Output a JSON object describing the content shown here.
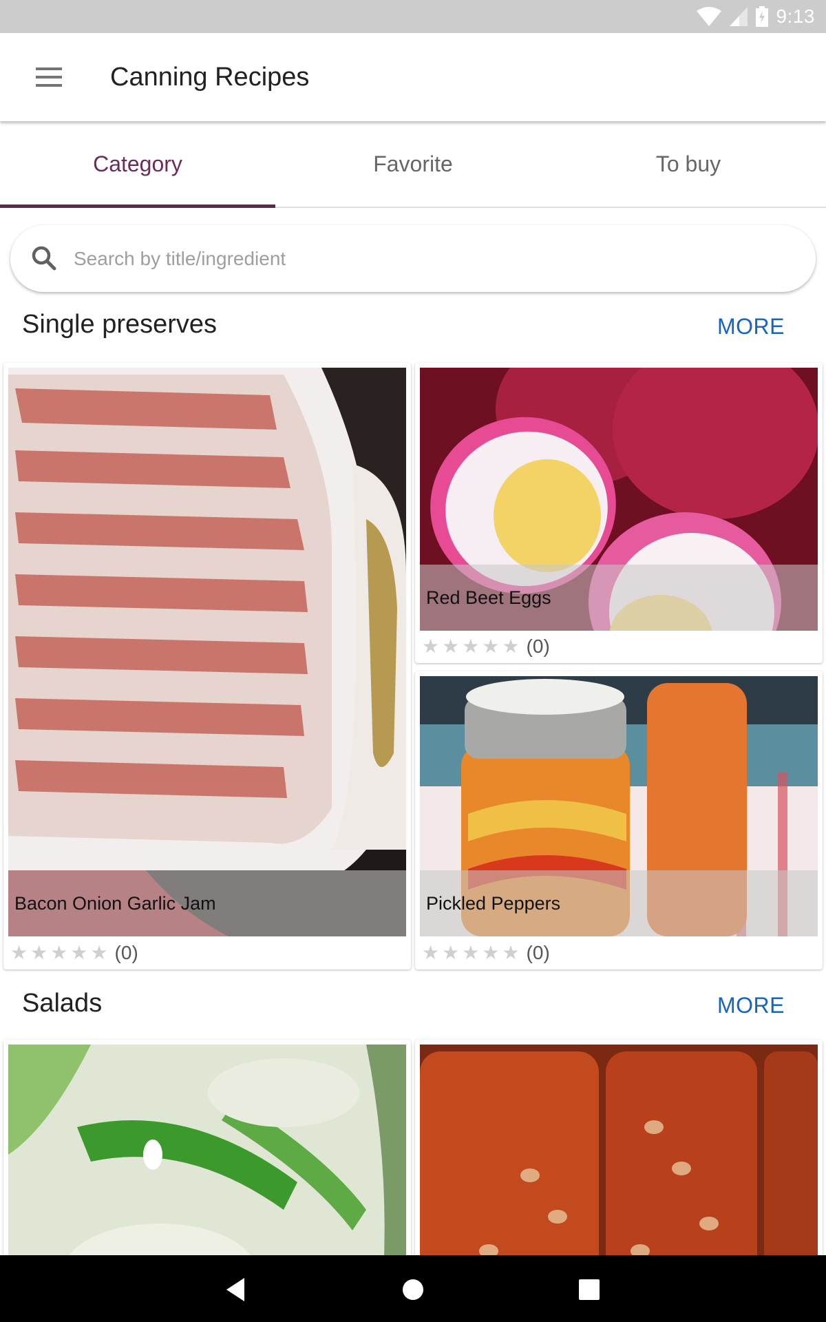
{
  "status_bar": {
    "time": "9:13",
    "icons": [
      "wifi-icon",
      "cell-signal-icon",
      "battery-charging-icon"
    ]
  },
  "app_bar": {
    "menu_icon": "hamburger-menu-icon",
    "title": "Canning Recipes"
  },
  "tabs": [
    {
      "label": "Category",
      "active": true
    },
    {
      "label": "Favorite",
      "active": false
    },
    {
      "label": "To buy",
      "active": false
    }
  ],
  "search": {
    "icon": "search-icon",
    "placeholder": "Search by title/ingredient",
    "value": ""
  },
  "sections": [
    {
      "title": "Single preserves",
      "more_label": "MORE",
      "recipes": [
        {
          "title": "Bacon Onion Garlic Jam",
          "rating": 0,
          "max_rating": 5,
          "rating_count": "(0)"
        },
        {
          "title": "Red Beet Eggs",
          "rating": 0,
          "max_rating": 5,
          "rating_count": "(0)"
        },
        {
          "title": "Pickled Peppers",
          "rating": 0,
          "max_rating": 5,
          "rating_count": "(0)"
        }
      ]
    },
    {
      "title": "Salads",
      "more_label": "MORE",
      "recipes": [
        {
          "title": "",
          "rating": 0
        },
        {
          "title": "",
          "rating": 0
        }
      ]
    }
  ],
  "colors": {
    "accent": "#5e2750",
    "active_tab_text": "#6a2c5b",
    "link": "#1565c0",
    "status_bar": "#cccccc"
  },
  "nav_bar": {
    "buttons": [
      "back-icon",
      "home-icon",
      "recents-icon"
    ]
  }
}
